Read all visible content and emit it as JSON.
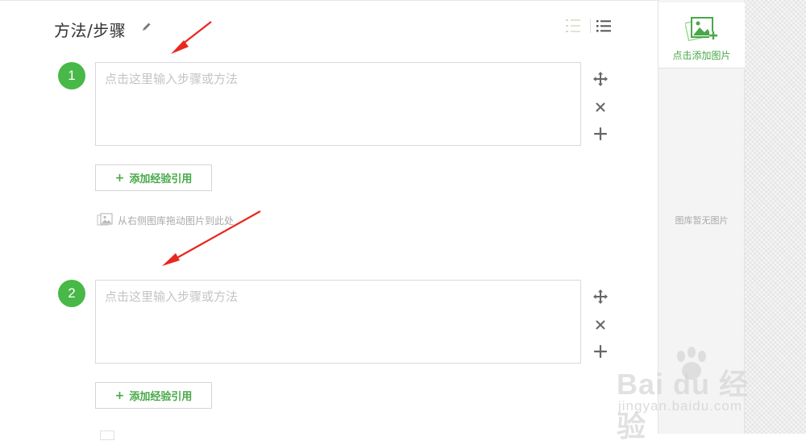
{
  "header": {
    "title": "方法/步骤"
  },
  "steps": [
    {
      "number": "1",
      "placeholder": "点击这里输入步骤或方法",
      "cite_label": "添加经验引用",
      "drag_hint": "从右侧图库拖动图片到此处"
    },
    {
      "number": "2",
      "placeholder": "点击这里输入步骤或方法",
      "cite_label": "添加经验引用"
    }
  ],
  "panel": {
    "add_image_label": "点击添加图片",
    "empty_label": "图库暂无图片"
  },
  "watermark": {
    "text": "Bai du 经验",
    "url": "jingyan.baidu.com"
  },
  "colors": {
    "accent_green": "#48b848",
    "annotation_red": "#e8271f"
  },
  "icons": [
    "edit-icon",
    "ordered-list-icon",
    "unordered-list-icon",
    "move-icon",
    "close-icon",
    "plus-icon",
    "image-icon",
    "add-image-icon",
    "paw-icon"
  ]
}
